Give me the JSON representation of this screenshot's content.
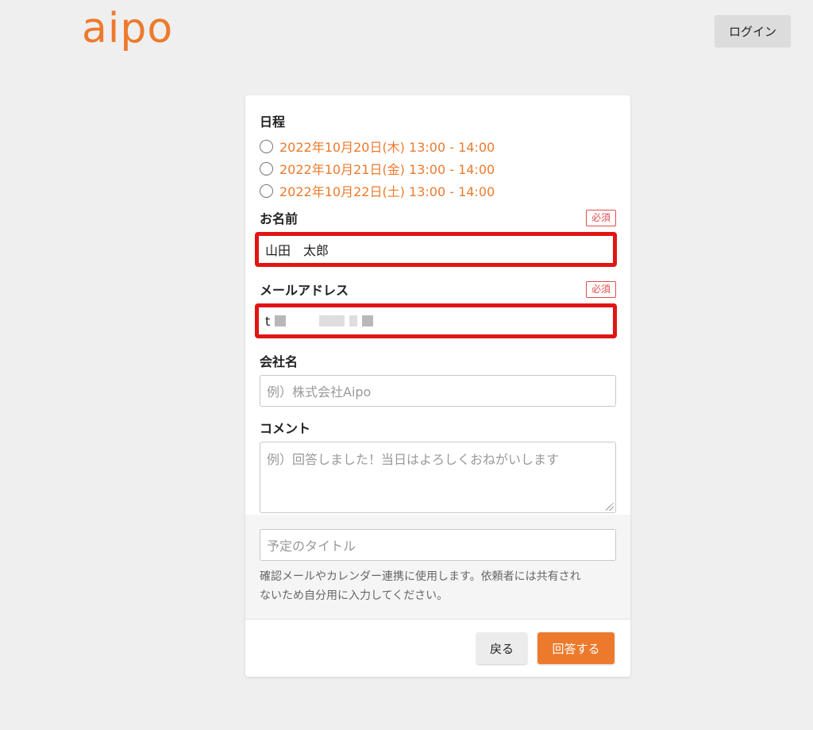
{
  "app": {
    "logo_text": "aipo",
    "login_label": "ログイン"
  },
  "colors": {
    "accent": "#ed7a2c",
    "required": "#e34b4b",
    "highlight": "#e11515"
  },
  "schedule": {
    "label": "日程",
    "options": [
      "2022年10月20日(木) 13:00 - 14:00",
      "2022年10月21日(金) 13:00 - 14:00",
      "2022年10月22日(土) 13:00 - 14:00"
    ]
  },
  "name_field": {
    "label": "お名前",
    "required": "必須",
    "value": "山田　太郎"
  },
  "email_field": {
    "label": "メールアドレス",
    "required": "必須",
    "value_prefix": "t"
  },
  "company_field": {
    "label": "会社名",
    "placeholder": "例）株式会社Aipo"
  },
  "comment_field": {
    "label": "コメント",
    "placeholder": "例）回答しました！当日はよろしくおねがいします"
  },
  "title_field": {
    "placeholder": "予定のタイトル",
    "help_line1": "確認メールやカレンダー連携に使用します。依頼者には共有され",
    "help_line2": "ないため自分用に入力してください。"
  },
  "actions": {
    "back_label": "戻る",
    "submit_label": "回答する"
  }
}
